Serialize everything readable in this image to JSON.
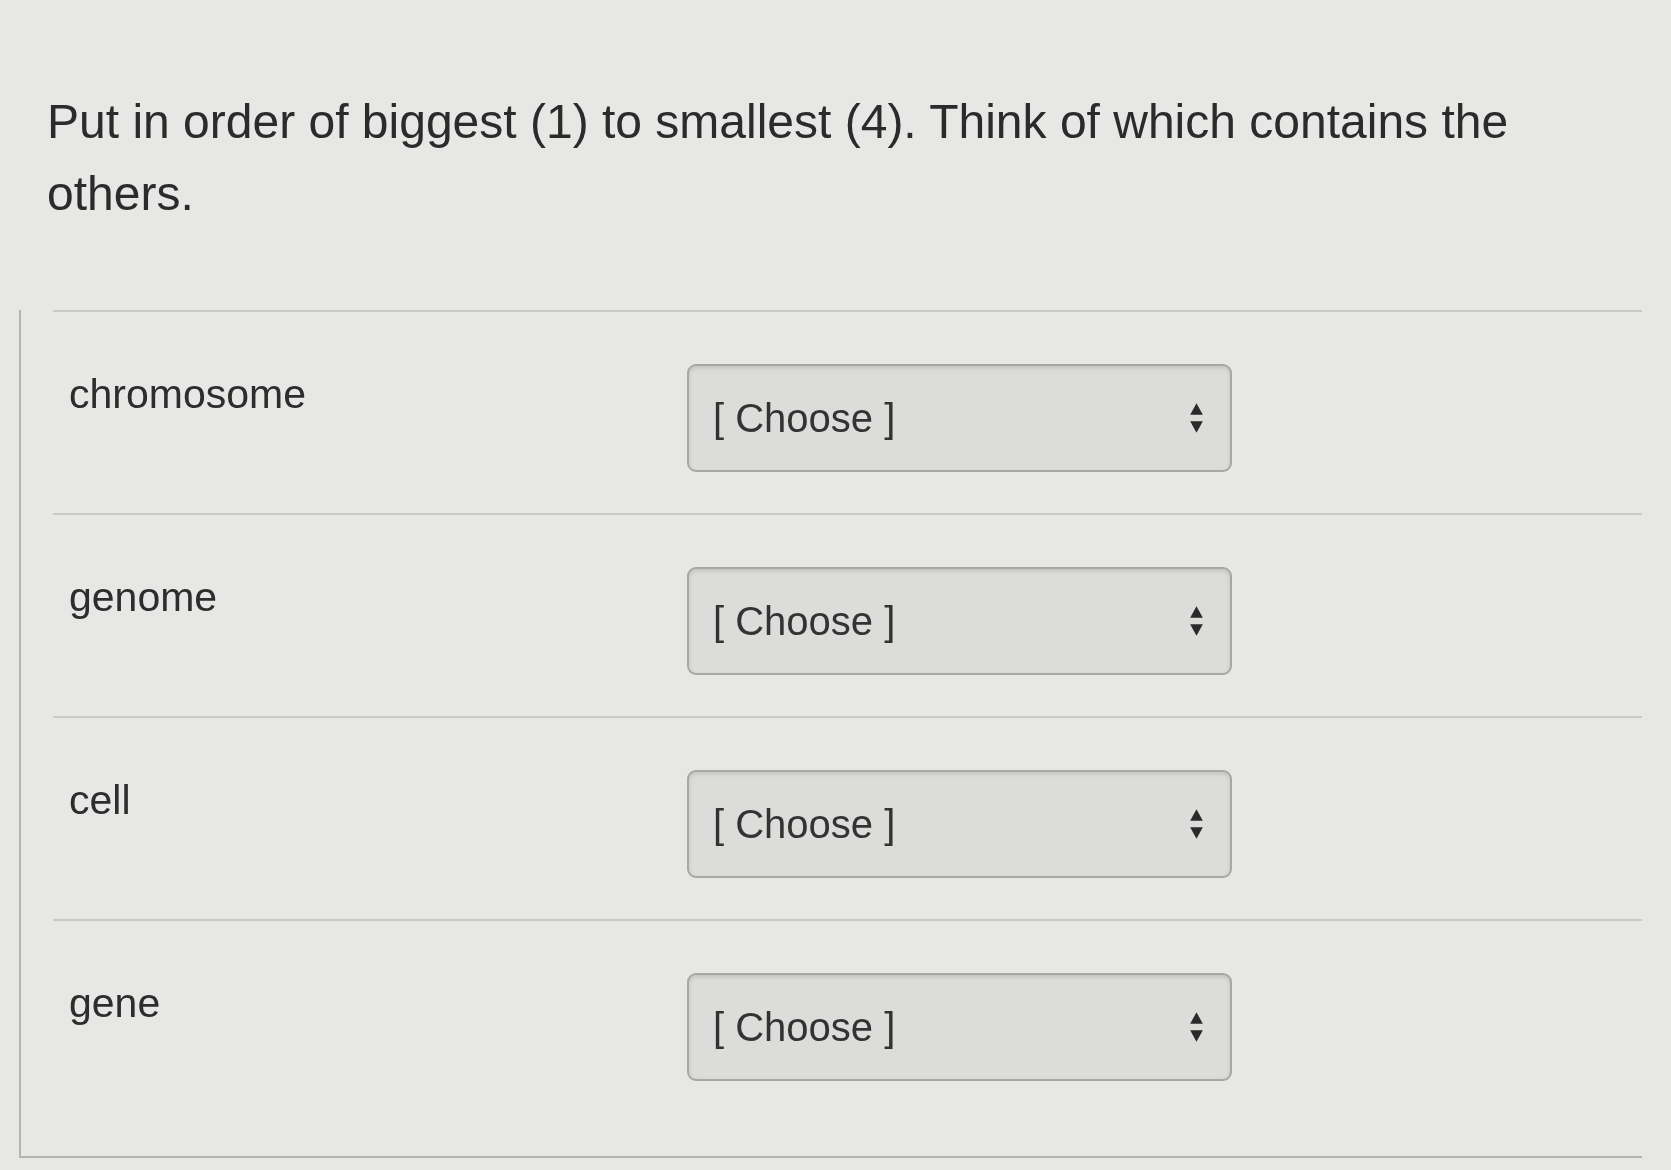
{
  "question": {
    "text": "Put in order of biggest (1) to smallest (4). Think of which contains the others."
  },
  "items": [
    {
      "label": "chromosome",
      "select": {
        "value": "[ Choose ]"
      }
    },
    {
      "label": "genome",
      "select": {
        "value": "[ Choose ]"
      }
    },
    {
      "label": "cell",
      "select": {
        "value": "[ Choose ]"
      }
    },
    {
      "label": "gene",
      "select": {
        "value": "[ Choose ]"
      }
    }
  ]
}
